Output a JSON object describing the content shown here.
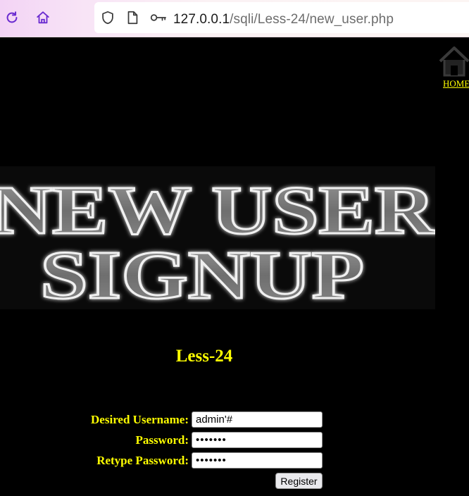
{
  "browser": {
    "url_host": "127.0.0.1",
    "url_path": "/sqli/Less-24/new_user.php",
    "reload_icon": "reload-icon",
    "home_icon": "home-icon",
    "shield_icon": "shield-icon",
    "page_icon": "page-icon",
    "key_icon": "key-icon"
  },
  "page": {
    "home_link_label": "HOME",
    "banner_line1": "NEW USER",
    "banner_line2": "SIGNUP",
    "title": "Less-24"
  },
  "form": {
    "username_label": "Desired Username:",
    "username_value": "admin'#",
    "password_label": "Password:",
    "password_value": "•••••••",
    "retype_label": "Retype Password:",
    "retype_value": "•••••••",
    "submit_label": "Register"
  },
  "colors": {
    "background": "#000000",
    "label_text": "#ffff00"
  }
}
